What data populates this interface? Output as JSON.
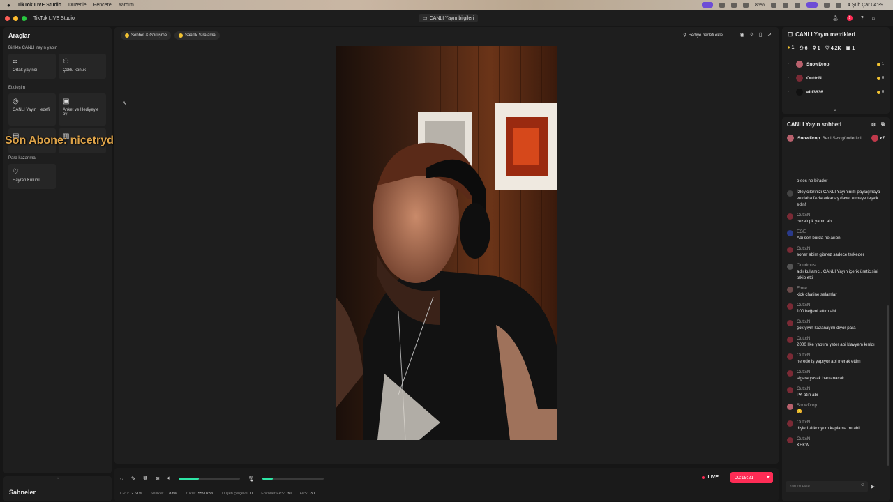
{
  "menubar": {
    "app_name": "TikTok LIVE Studio",
    "menus": [
      "Düzenle",
      "Pencere",
      "Yardım"
    ],
    "battery": "85%",
    "clock": "4 Şub Çar  04:39"
  },
  "titlebar": {
    "title": "TikTok LIVE Studio",
    "center_chip": "CANLI Yayın bilgileri",
    "notif_count": "1"
  },
  "tools": {
    "title": "Araçlar",
    "section_together": "Birlikte CANLI Yayın yapın",
    "together_items": [
      "Ortak yayıncı",
      "Çoklu konuk"
    ],
    "section_interaction": "Etkileşim",
    "interaction_items": [
      "CANLI Yayın Hedefi",
      "Anket ve Hediyeyle oy"
    ],
    "section_money": "Para kazanma",
    "money_items": [
      "Hayran Kulübü"
    ]
  },
  "overlay": {
    "text": "Son Abone: nicetrydiddyverynice"
  },
  "scenes": {
    "title": "Sahneler"
  },
  "center": {
    "pills": [
      "Sohbet & Görüşme",
      "Saatlik Sıralama"
    ],
    "gift_goal": "Hediye hedefi ekle"
  },
  "controls": {
    "volume_fill": 0.33,
    "mic_fill": 0.17,
    "live_label": "LIVE",
    "timer": "00:19:21",
    "stats": [
      {
        "label": "CPU:",
        "value": "2.61%"
      },
      {
        "label": "Sellikle:",
        "value": "1.83%"
      },
      {
        "label": "Yükle:",
        "value": "5590kb/s"
      },
      {
        "label": "Düşen çerçeve:",
        "value": "0"
      },
      {
        "label": "Encoder FPS:",
        "value": "30"
      },
      {
        "label": "FPS:",
        "value": "30"
      }
    ]
  },
  "metrics": {
    "title": "CANLI Yayın metrikleri",
    "values": [
      "1",
      "6",
      "1",
      "4.2K",
      "1"
    ],
    "viewers": [
      {
        "name": "SnowDrop",
        "coins": "1",
        "color": "#b9616d"
      },
      {
        "name": "OuttcN",
        "coins": "0",
        "color": "#7a2a35"
      },
      {
        "name": "elif3636",
        "coins": "0",
        "color": "#111111"
      }
    ]
  },
  "chat": {
    "title": "CANLI Yayın sohbeti",
    "gift_user": "SnowDrop",
    "gift_text": "Beni Sev gönderildi",
    "gift_count": "x7",
    "input_placeholder": "Yorum ekle",
    "messages": [
      {
        "user": "",
        "text": "o ses ne birader",
        "color": "#1e1e1e"
      },
      {
        "user": "",
        "text": "İzleyicilerinizi CANLI Yayınınızı paylaşmaya ve daha fazla arkadaş davet etmeye teşvik edin!",
        "color": "#444444"
      },
      {
        "user": "OuttcN",
        "text": "cezalı pk yapın abi",
        "color": "#7a2a35"
      },
      {
        "user": "EGE",
        "text": "Abi sen burda ne arıon",
        "color": "#2a3a8a"
      },
      {
        "user": "OuttcN",
        "text": "soner abim gitmez sadece terkeder",
        "color": "#7a2a35"
      },
      {
        "user": "Onurimus",
        "text": "adlı kullanıcı, CANLI Yayın içerik üreticisini takip etti",
        "color": "#555555"
      },
      {
        "user": "Emre",
        "text": "kick chatine selamlar",
        "color": "#6a4a4a"
      },
      {
        "user": "OuttcN",
        "text": "100 beğeni attım abi",
        "color": "#7a2a35"
      },
      {
        "user": "OuttcN",
        "text": "çok yiyin kazanayım diyor para",
        "color": "#7a2a35"
      },
      {
        "user": "OuttcN",
        "text": "2000 like yaptım yeter abi klavyem kırıldı",
        "color": "#7a2a35"
      },
      {
        "user": "OuttcN",
        "text": "nerede iş yapıyor abi merak ettim",
        "color": "#7a2a35"
      },
      {
        "user": "OuttcN",
        "text": "sigara yasak banlanacak",
        "color": "#7a2a35"
      },
      {
        "user": "OuttcN",
        "text": "PK atın abi",
        "color": "#7a2a35"
      },
      {
        "user": "SnowDrop",
        "text": "😊",
        "color": "#b9616d"
      },
      {
        "user": "OuttcN",
        "text": "dişleri zirkonyum kaplama mı abi",
        "color": "#7a2a35"
      },
      {
        "user": "OuttcN",
        "text": "KEKW",
        "color": "#7a2a35"
      }
    ]
  }
}
